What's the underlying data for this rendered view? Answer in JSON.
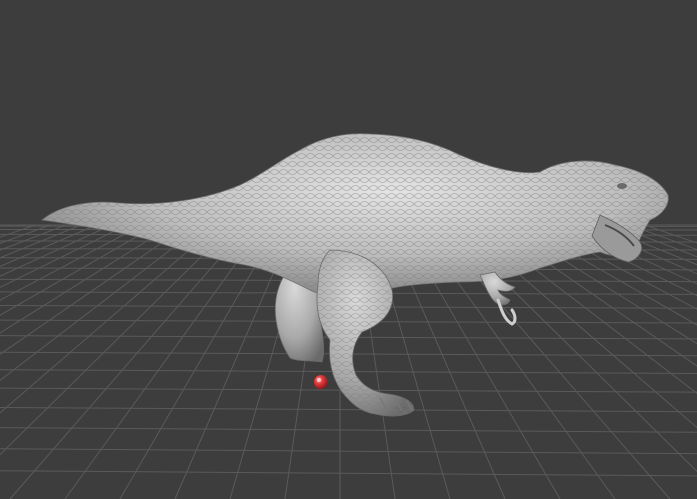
{
  "viewport": {
    "background_color": "#3d3d3d",
    "grid_color": "#5a5a5a",
    "grid_visible": true
  },
  "model": {
    "description_icon": "trex-model-icon",
    "base_color": "#bdbdbd",
    "highlight_color": "#e6e6e6",
    "shadow_color": "#6f6f6f"
  },
  "marker": {
    "icon": "red-sphere-marker-icon",
    "color": "#e03a3a"
  }
}
